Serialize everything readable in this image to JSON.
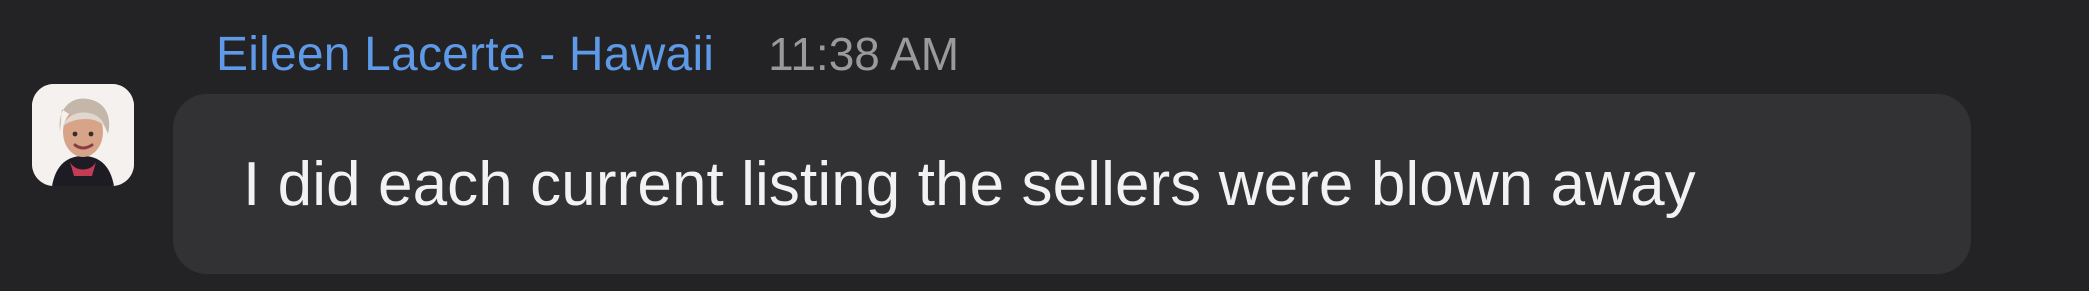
{
  "message": {
    "sender_name": "Eileen Lacerte - Hawaii",
    "timestamp": "11:38 AM",
    "text": "I did each current listing the sellers were blown away",
    "avatar_icon": "user-photo-avatar"
  },
  "colors": {
    "background": "#232325",
    "bubble": "#323234",
    "sender_name": "#5e9ae8",
    "timestamp": "#9a9a9c",
    "message_text": "#f2f2f2"
  }
}
